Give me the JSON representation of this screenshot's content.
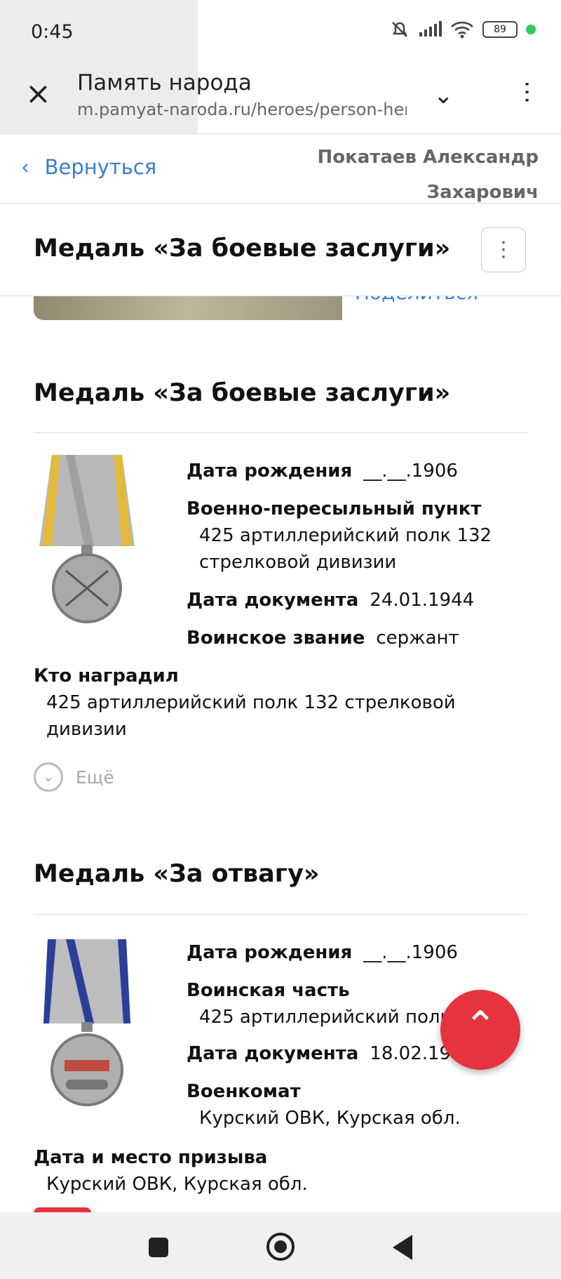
{
  "status_bar": {
    "time": "0:45",
    "battery": "89"
  },
  "browser": {
    "title": "Память народа",
    "url": "m.pamyat-naroda.ru/heroes/person-hero"
  },
  "nav_header": {
    "back_label": "Вернуться",
    "person_line1": "Покатаев Александр",
    "person_line2": "Захарович"
  },
  "sticky_title": "Медаль «За боевые заслуги»",
  "share_label": "Поделиться",
  "award1": {
    "title": "Медаль «За боевые заслуги»",
    "birth_label": "Дата рождения",
    "birth_value": "__.__.1906",
    "vpp_label": "Военно-пересыльный пункт",
    "vpp_value_1": "425 артиллерийский полк 132",
    "vpp_value_2": "стрелковой дивизии",
    "doc_label": "Дата документа",
    "doc_value": "24.01.1944",
    "rank_label": "Воинское звание",
    "rank_value": "сержант",
    "who_label": "Кто наградил",
    "who_value_1": "425 артиллерийский полк 132 стрелковой",
    "who_value_2": "дивизии",
    "more_label": "Ещё"
  },
  "award2": {
    "title": "Медаль «За отвагу»",
    "birth_label": "Дата рождения",
    "birth_value": "__.__.1906",
    "unit_label": "Воинская часть",
    "unit_value": "425 артиллерийский полк",
    "doc_label": "Дата документа",
    "doc_value": "18.02.1945",
    "vk_label": "Военкомат",
    "vk_value": "Курский ОВК, Курская обл.",
    "draft_label": "Дата и место призыва",
    "draft_value": "Курский ОВК, Курская обл."
  }
}
